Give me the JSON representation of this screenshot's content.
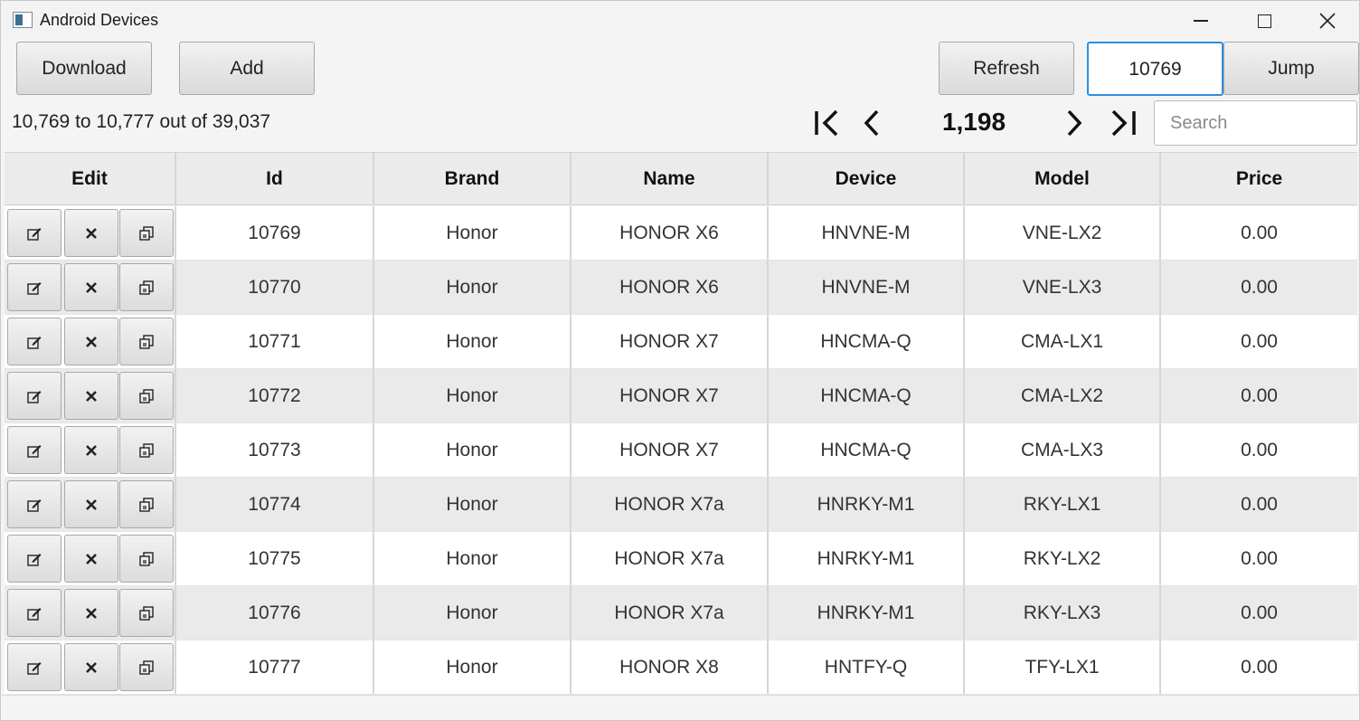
{
  "window": {
    "title": "Android Devices"
  },
  "toolbar": {
    "download_label": "Download",
    "add_label": "Add",
    "refresh_label": "Refresh",
    "jump_value": "10769",
    "jump_label": "Jump"
  },
  "pager": {
    "range_text": "10,769 to 10,777 out of 39,037",
    "page": "1,198",
    "search_placeholder": "Search"
  },
  "table": {
    "columns": [
      "Edit",
      "Id",
      "Brand",
      "Name",
      "Device",
      "Model",
      "Price"
    ],
    "rows": [
      {
        "id": "10769",
        "brand": "Honor",
        "name": "HONOR X6",
        "device": "HNVNE-M",
        "model": "VNE-LX2",
        "price": "0.00"
      },
      {
        "id": "10770",
        "brand": "Honor",
        "name": "HONOR X6",
        "device": "HNVNE-M",
        "model": "VNE-LX3",
        "price": "0.00"
      },
      {
        "id": "10771",
        "brand": "Honor",
        "name": "HONOR X7",
        "device": "HNCMA-Q",
        "model": "CMA-LX1",
        "price": "0.00"
      },
      {
        "id": "10772",
        "brand": "Honor",
        "name": "HONOR X7",
        "device": "HNCMA-Q",
        "model": "CMA-LX2",
        "price": "0.00"
      },
      {
        "id": "10773",
        "brand": "Honor",
        "name": "HONOR X7",
        "device": "HNCMA-Q",
        "model": "CMA-LX3",
        "price": "0.00"
      },
      {
        "id": "10774",
        "brand": "Honor",
        "name": "HONOR X7a",
        "device": "HNRKY-M1",
        "model": "RKY-LX1",
        "price": "0.00"
      },
      {
        "id": "10775",
        "brand": "Honor",
        "name": "HONOR X7a",
        "device": "HNRKY-M1",
        "model": "RKY-LX2",
        "price": "0.00"
      },
      {
        "id": "10776",
        "brand": "Honor",
        "name": "HONOR X7a",
        "device": "HNRKY-M1",
        "model": "RKY-LX3",
        "price": "0.00"
      },
      {
        "id": "10777",
        "brand": "Honor",
        "name": "HONOR X8",
        "device": "HNTFY-Q",
        "model": "TFY-LX1",
        "price": "0.00"
      }
    ]
  },
  "colors": {
    "accent": "#2f8fdf",
    "row_alt": "#eaeaea",
    "header": "#ebebeb"
  },
  "icons": {
    "row_actions": [
      "edit-icon",
      "delete-icon",
      "copy-icon"
    ],
    "pager": [
      "first-page-icon",
      "prev-page-icon",
      "next-page-icon",
      "last-page-icon"
    ]
  }
}
